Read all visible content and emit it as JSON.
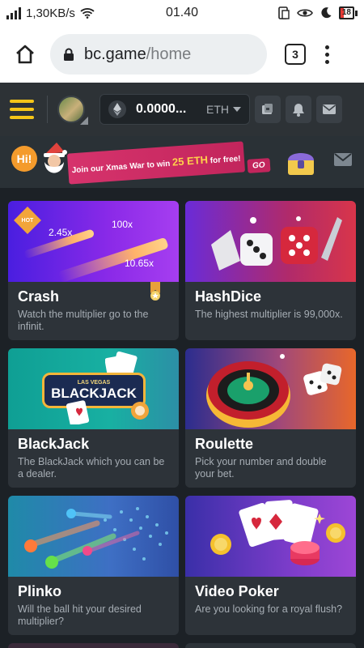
{
  "status_bar": {
    "speed": "1,30KB/s",
    "time": "01.40",
    "battery": "18",
    "battery_color": "#e53935"
  },
  "browser": {
    "url_domain": "bc.game",
    "url_path": "/home",
    "tab_count": "3"
  },
  "header": {
    "balance": "0.0000...",
    "currency": "ETH",
    "accent_color": "#f5c518"
  },
  "banner": {
    "hi_label": "Hi!",
    "text_prefix": "Join our Xmas War to win",
    "text_highlight": "25 ETH",
    "text_suffix": "for free!",
    "go_label": "GO"
  },
  "games": [
    {
      "title": "Crash",
      "description": "Watch the multiplier go to the infinit.",
      "badge": "HOT",
      "multipliers": [
        "2.45x",
        "100x",
        "10.65x"
      ]
    },
    {
      "title": "HashDice",
      "description": "The highest multiplier is 99,000x."
    },
    {
      "title": "BlackJack",
      "description": "The BlackJack which you can be a dealer.",
      "sign_top": "LAS VEGAS",
      "sign_main": "BLACKJACK"
    },
    {
      "title": "Roulette",
      "description": "Pick your number and double your bet."
    },
    {
      "title": "Plinko",
      "description": "Will the ball hit your desired multiplier?"
    },
    {
      "title": "Video Poker",
      "description": "Are you looking for a royal flush?"
    }
  ]
}
